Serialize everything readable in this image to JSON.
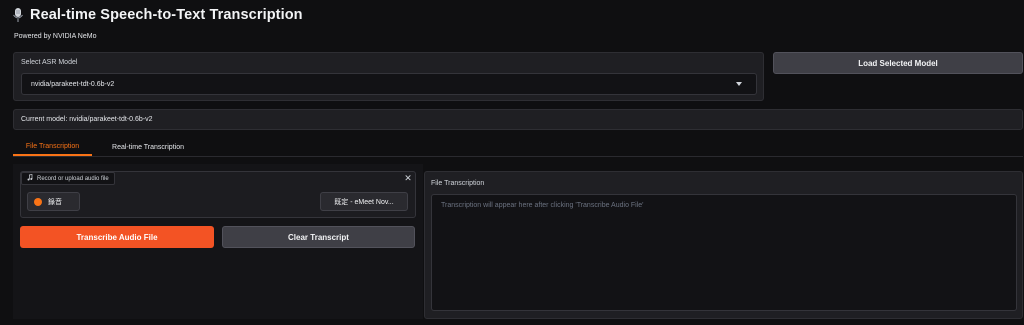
{
  "app": {
    "title": "Real-time Speech-to-Text Transcription",
    "title_icon": "microphone-icon",
    "powered_by": "Powered by NVIDIA NeMo"
  },
  "model_selector": {
    "label": "Select ASR Model",
    "selected": "nvidia/parakeet-tdt-0.6b-v2",
    "load_button": "Load Selected Model"
  },
  "current_model": "Current model: nvidia/parakeet-tdt-0.6b-v2",
  "tabs": [
    {
      "label": "File Transcription",
      "active": true
    },
    {
      "label": "Real-time Transcription",
      "active": false
    }
  ],
  "audio_input": {
    "label": "Record or upload audio file",
    "record_label": "錄音",
    "device": "既定 - eMeet Nov...",
    "close": "✕"
  },
  "actions": {
    "transcribe": "Transcribe Audio File",
    "clear": "Clear Transcript"
  },
  "output": {
    "label": "File Transcription",
    "placeholder": "Transcription will appear here after clicking 'Transcribe Audio File'"
  },
  "colors": {
    "accent": "#f97316",
    "primary_button": "#f35324",
    "background": "#0f0f11"
  }
}
